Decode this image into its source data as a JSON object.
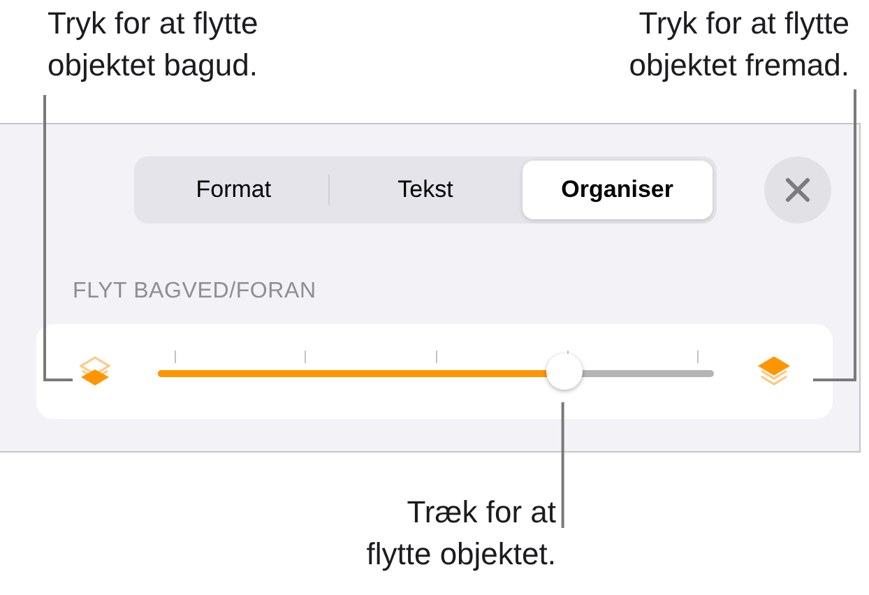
{
  "callouts": {
    "top_left": [
      "Tryk for at flytte",
      "objektet bagud."
    ],
    "top_right": [
      "Tryk for at flytte",
      "objektet fremad."
    ],
    "bottom": [
      "Træk for at",
      "flytte objektet."
    ]
  },
  "tabs": [
    {
      "label": "Format",
      "selected": false
    },
    {
      "label": "Tekst",
      "selected": false
    },
    {
      "label": "Organiser",
      "selected": true
    }
  ],
  "section_label": "FLYT BAGVED/FORAN",
  "slider": {
    "level": 0.73
  }
}
